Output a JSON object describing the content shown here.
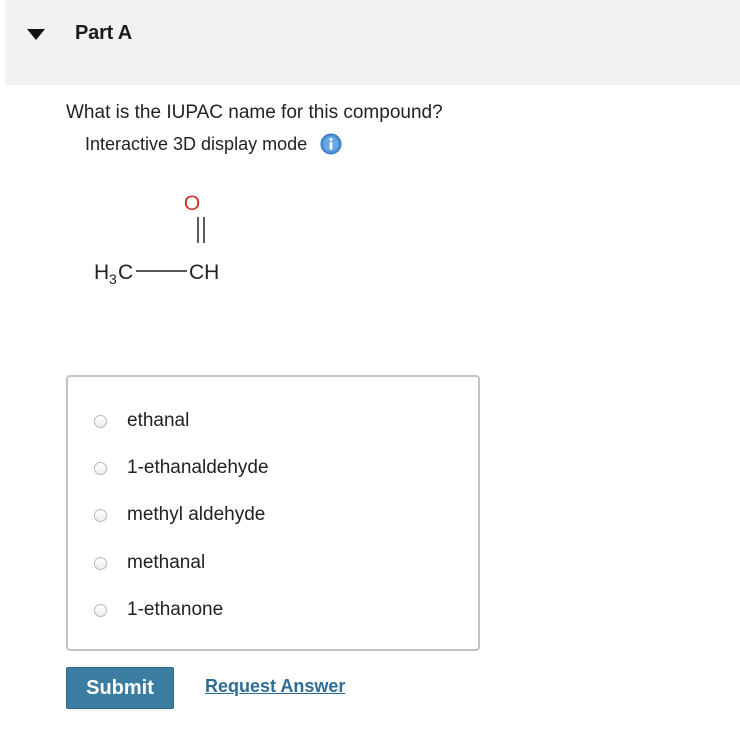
{
  "part": {
    "title": "Part A"
  },
  "question": {
    "text": "What is the IUPAC name for this compound?",
    "display_mode": "Interactive 3D display mode"
  },
  "structure": {
    "methyl_label": "H",
    "methyl_subscript": "3",
    "methyl_carbon": "C",
    "carbonyl_group": "CH",
    "oxygen": "O",
    "oxygen_color": "#d0342c"
  },
  "options": [
    {
      "label": "ethanal",
      "selected": false
    },
    {
      "label": "1-ethanaldehyde",
      "selected": false
    },
    {
      "label": "methyl aldehyde",
      "selected": false
    },
    {
      "label": "methanal",
      "selected": false
    },
    {
      "label": "1-ethanone",
      "selected": false
    }
  ],
  "actions": {
    "submit_label": "Submit",
    "request_label": "Request Answer"
  },
  "colors": {
    "accent": "#3b7da1",
    "link": "#2d6e96",
    "info_icon": "#4a90d9"
  },
  "icons": {
    "collapse": "triangle-down-icon",
    "info": "info-icon"
  }
}
